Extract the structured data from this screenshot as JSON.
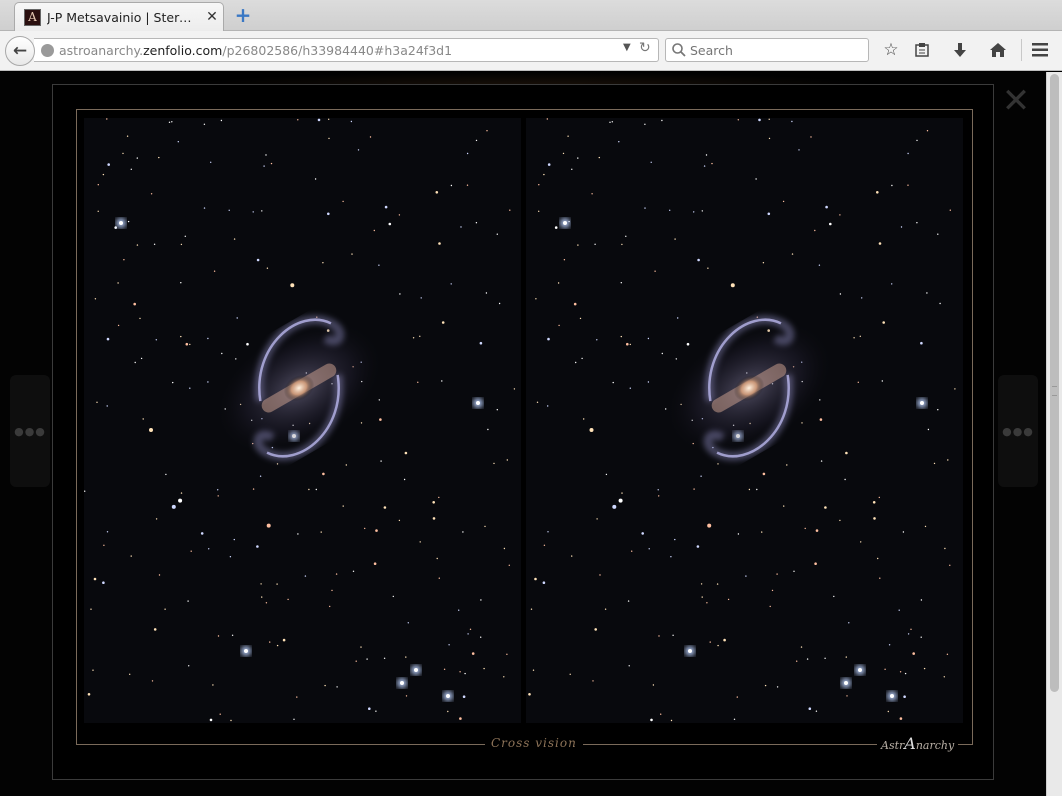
{
  "browser": {
    "tab_title": "J-P Metsavainio | Stereo...",
    "favicon_letter": "A",
    "url_prefix": "astroanarchy.",
    "url_domain": "zenfolio.com",
    "url_path": "/p26802586/h33984440#h3a24f3d1",
    "search_placeholder": "Search"
  },
  "lightbox": {
    "caption": "Cross vision",
    "signature_prefix": "Astr",
    "signature_mark": "A",
    "signature_suffix": "narchy"
  },
  "colors": {
    "frame": "#7a6a5a",
    "caption": "#8d7358",
    "sky": "#08090d"
  },
  "icons": {
    "back": "arrow-left-icon",
    "reload": "reload-icon",
    "search": "search-icon",
    "bookmark": "star-icon",
    "reading_list": "clipboard-icon",
    "downloads": "download-icon",
    "home": "home-icon",
    "menu": "hamburger-icon",
    "close": "close-icon",
    "prev": "dots-icon",
    "next": "dots-icon"
  }
}
